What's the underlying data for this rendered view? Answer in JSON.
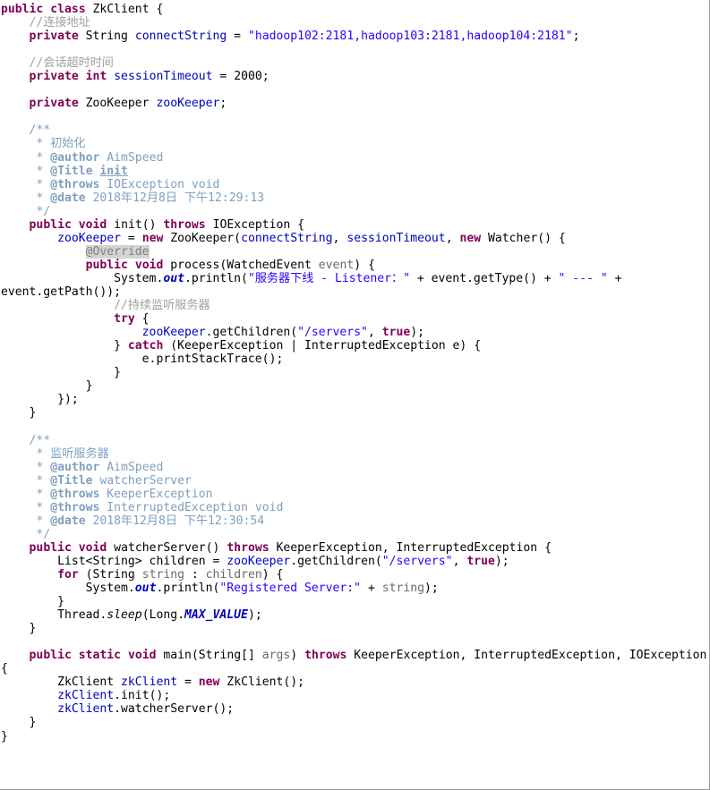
{
  "editor": {
    "language": "java",
    "class_name": "ZkClient",
    "background_color": "#ffffff",
    "default_text_color": "#000000",
    "colors": {
      "keyword": "#7f0055",
      "field": "#0000c0",
      "string": "#2a00ff",
      "line_comment": "#9aa39a",
      "javadoc": "#7f9fbf",
      "parameter": "#6a6a6a",
      "annotation_highlight_bg": "#d4d4d4",
      "annotation_text": "#808080",
      "border": "#9a9a9a"
    }
  },
  "code": {
    "lines": [
      {
        "id": "l1",
        "text": "public class ZkClient {"
      },
      {
        "id": "l2",
        "text": "    //连接地址"
      },
      {
        "id": "l3",
        "text": "    private String connectString = \"hadoop102:2181,hadoop103:2181,hadoop104:2181\";"
      },
      {
        "id": "l4",
        "text": ""
      },
      {
        "id": "l5",
        "text": "    //会话超时时间"
      },
      {
        "id": "l6",
        "text": "    private int sessionTimeout = 2000;"
      },
      {
        "id": "l7",
        "text": ""
      },
      {
        "id": "l8",
        "text": "    private ZooKeeper zooKeeper;"
      },
      {
        "id": "l9",
        "text": ""
      },
      {
        "id": "l10",
        "text": "    /**"
      },
      {
        "id": "l11",
        "text": "     * 初始化"
      },
      {
        "id": "l12",
        "text": "     * @author AimSpeed"
      },
      {
        "id": "l13",
        "text": "     * @Title init"
      },
      {
        "id": "l14",
        "text": "     * @throws IOException void"
      },
      {
        "id": "l15",
        "text": "     * @date 2018年12月8日 下午12:29:13"
      },
      {
        "id": "l16",
        "text": "     */"
      },
      {
        "id": "l17",
        "text": "    public void init() throws IOException {"
      },
      {
        "id": "l18",
        "text": "        zooKeeper = new ZooKeeper(connectString, sessionTimeout, new Watcher() {"
      },
      {
        "id": "l19",
        "text": "            @Override"
      },
      {
        "id": "l20",
        "text": "            public void process(WatchedEvent event) {"
      },
      {
        "id": "l21",
        "text": "                System.out.println(\"服务器下线 - Listener：\" + event.getType() + \" --- \" + event.getPath());"
      },
      {
        "id": "l22",
        "text": "                //持续监听服务器"
      },
      {
        "id": "l23",
        "text": "                try {"
      },
      {
        "id": "l24",
        "text": "                    zooKeeper.getChildren(\"/servers\", true);"
      },
      {
        "id": "l25",
        "text": "                } catch (KeeperException | InterruptedException e) {"
      },
      {
        "id": "l26",
        "text": "                    e.printStackTrace();"
      },
      {
        "id": "l27",
        "text": "                }"
      },
      {
        "id": "l28",
        "text": "            }"
      },
      {
        "id": "l29",
        "text": "        });"
      },
      {
        "id": "l30",
        "text": "    }"
      },
      {
        "id": "l31",
        "text": ""
      },
      {
        "id": "l32",
        "text": "    /**"
      },
      {
        "id": "l33",
        "text": "     * 监听服务器"
      },
      {
        "id": "l34",
        "text": "     * @author AimSpeed"
      },
      {
        "id": "l35",
        "text": "     * @Title watcherServer"
      },
      {
        "id": "l36",
        "text": "     * @throws KeeperException"
      },
      {
        "id": "l37",
        "text": "     * @throws InterruptedException void"
      },
      {
        "id": "l38",
        "text": "     * @date 2018年12月8日 下午12:30:54"
      },
      {
        "id": "l39",
        "text": "     */"
      },
      {
        "id": "l40",
        "text": "    public void watcherServer() throws KeeperException, InterruptedException {"
      },
      {
        "id": "l41",
        "text": "        List<String> children = zooKeeper.getChildren(\"/servers\", true);"
      },
      {
        "id": "l42",
        "text": "        for (String string : children) {"
      },
      {
        "id": "l43",
        "text": "            System.out.println(\"Registered Server:\" + string);"
      },
      {
        "id": "l44",
        "text": "        }"
      },
      {
        "id": "l45",
        "text": "        Thread.sleep(Long.MAX_VALUE);"
      },
      {
        "id": "l46",
        "text": "    }"
      },
      {
        "id": "l47",
        "text": ""
      },
      {
        "id": "l48",
        "text": "    public static void main(String[] args) throws KeeperException, InterruptedException, IOException {"
      },
      {
        "id": "l49",
        "text": "        ZkClient zkClient = new ZkClient();"
      },
      {
        "id": "l50",
        "text": "        zkClient.init();"
      },
      {
        "id": "l51",
        "text": "        zkClient.watcherServer();"
      },
      {
        "id": "l52",
        "text": "    }"
      },
      {
        "id": "l53",
        "text": "}"
      }
    ],
    "highlighted_annotation": "@Override",
    "keywords": [
      "public",
      "class",
      "private",
      "int",
      "void",
      "new",
      "throws",
      "static",
      "try",
      "catch",
      "for",
      "true"
    ],
    "string_literals": [
      "\"hadoop102:2181,hadoop103:2181,hadoop104:2181\"",
      "\"服务器下线 - Listener：\"",
      "\" --- \"",
      "\"/servers\"",
      "\"Registered Server:\""
    ],
    "line_comments": [
      "//连接地址",
      "//会话超时时间",
      "//持续监听服务器"
    ],
    "javadoc_blocks": [
      {
        "summary": "初始化",
        "author": "AimSpeed",
        "title": "init",
        "throws": [
          "IOException void"
        ],
        "date": "2018年12月8日 下午12:29:13"
      },
      {
        "summary": "监听服务器",
        "author": "AimSpeed",
        "title": "watcherServer",
        "throws": [
          "KeeperException",
          "InterruptedException void"
        ],
        "date": "2018年12月8日 下午12:30:54"
      }
    ]
  }
}
